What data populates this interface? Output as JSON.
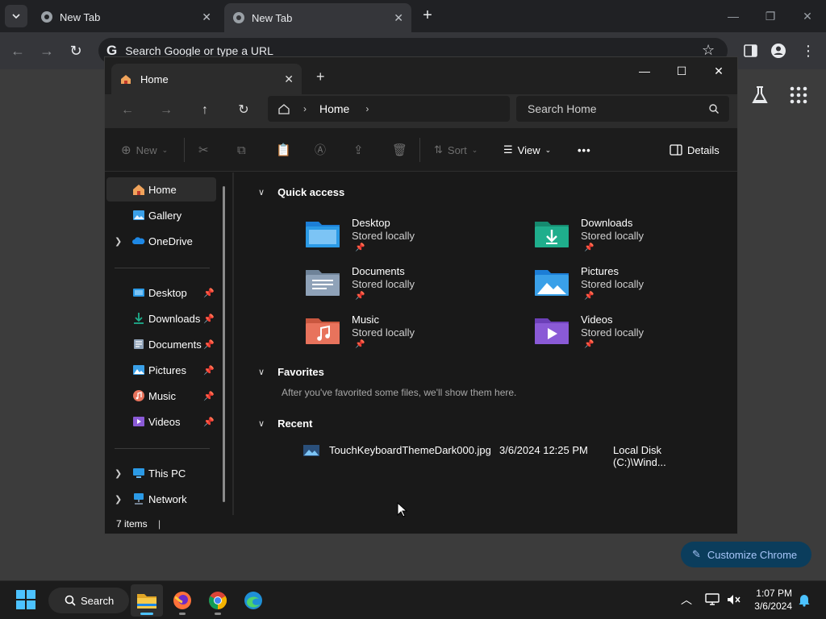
{
  "chrome": {
    "tabs": [
      {
        "title": "New Tab"
      },
      {
        "title": "New Tab"
      }
    ],
    "new_tab": "+",
    "omnibox_placeholder": "Search Google or type a URL",
    "customize_label": "Customize Chrome"
  },
  "explorer": {
    "tab_title": "Home",
    "breadcrumb": [
      "Home"
    ],
    "search_placeholder": "Search Home",
    "commands": {
      "new": "New",
      "sort": "Sort",
      "view": "View",
      "more": "•••",
      "details": "Details"
    },
    "sidebar": {
      "top": [
        {
          "label": "Home",
          "icon": "home-icon",
          "selected": true
        },
        {
          "label": "Gallery",
          "icon": "gallery-icon"
        },
        {
          "label": "OneDrive",
          "icon": "onedrive-icon",
          "expandable": true
        }
      ],
      "pinned": [
        {
          "label": "Desktop",
          "icon": "desktop-folder-icon"
        },
        {
          "label": "Downloads",
          "icon": "downloads-folder-icon"
        },
        {
          "label": "Documents",
          "icon": "documents-folder-icon"
        },
        {
          "label": "Pictures",
          "icon": "pictures-folder-icon"
        },
        {
          "label": "Music",
          "icon": "music-folder-icon"
        },
        {
          "label": "Videos",
          "icon": "videos-folder-icon"
        }
      ],
      "bottom": [
        {
          "label": "This PC",
          "icon": "this-pc-icon",
          "expandable": true
        },
        {
          "label": "Network",
          "icon": "network-icon",
          "expandable": true
        }
      ]
    },
    "quick_access": {
      "heading": "Quick access",
      "items": [
        {
          "name": "Desktop",
          "status": "Stored locally",
          "color": "#2b9ae6"
        },
        {
          "name": "Downloads",
          "status": "Stored locally",
          "color": "#1fae8c"
        },
        {
          "name": "Documents",
          "status": "Stored locally",
          "color": "#8fa2b8"
        },
        {
          "name": "Pictures",
          "status": "Stored locally",
          "color": "#3aa0e8"
        },
        {
          "name": "Music",
          "status": "Stored locally",
          "color": "#e8735c"
        },
        {
          "name": "Videos",
          "status": "Stored locally",
          "color": "#8a5ad6"
        }
      ]
    },
    "favorites": {
      "heading": "Favorites",
      "empty_message": "After you've favorited some files, we'll show them here."
    },
    "recent": {
      "heading": "Recent",
      "items": [
        {
          "name": "TouchKeyboardThemeDark000.jpg",
          "date": "3/6/2024 12:25 PM",
          "location": "Local Disk (C:)\\Wind..."
        }
      ]
    },
    "status": "7 items"
  },
  "taskbar": {
    "search_label": "Search",
    "time": "1:07 PM",
    "date": "3/6/2024"
  }
}
